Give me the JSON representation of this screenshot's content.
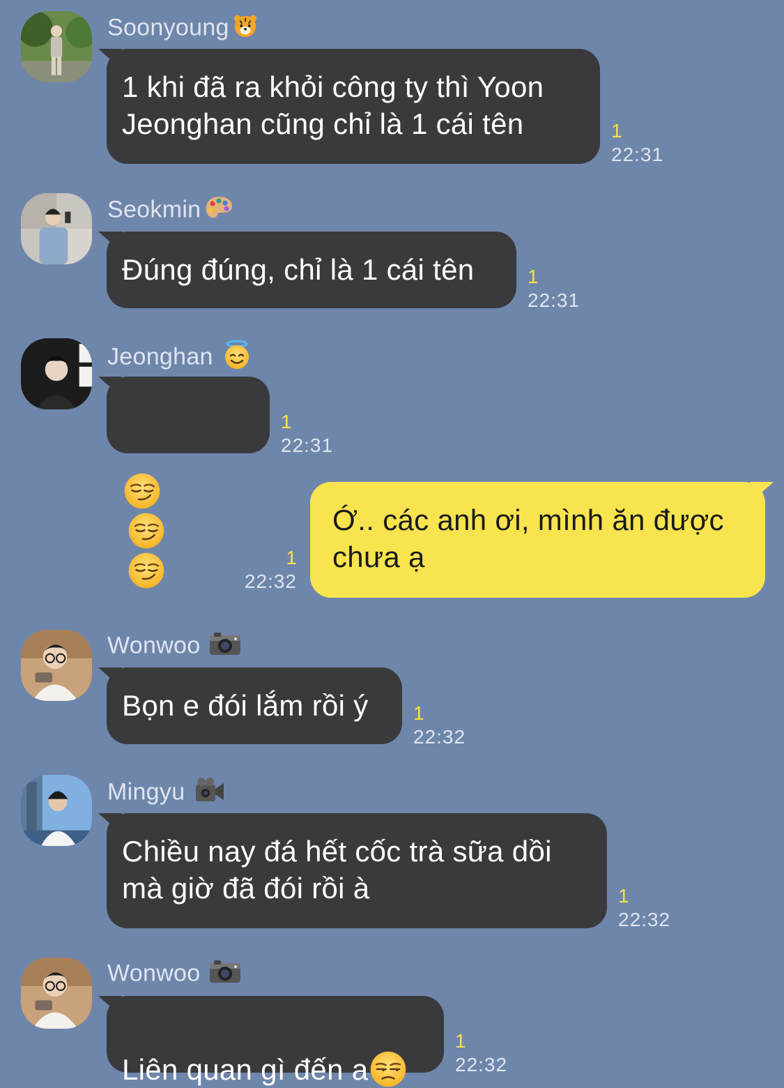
{
  "accent_colors": {
    "background": "#6f86ab",
    "incoming_bubble": "#3a3a3c",
    "outgoing_bubble": "#f8e44e",
    "unread": "#f5e04a"
  },
  "messages": [
    {
      "sender": "Soonyoung",
      "sender_icon": "tiger-icon",
      "text": "1 khi đã ra khỏi công ty thì Yoon\nJeonghan cũng chỉ là 1 cái tên",
      "unread": "1",
      "time": "22:31"
    },
    {
      "sender": "Seokmin",
      "sender_icon": "palette-icon",
      "text": "Đúng đúng, chỉ là 1 cái tên",
      "unread": "1",
      "time": "22:31"
    },
    {
      "sender": "Jeonghan",
      "sender_icon": "angel-face-icon",
      "text": "",
      "emojis": [
        "smirk-face-icon",
        "smirk-face-icon",
        "smirk-face-icon"
      ],
      "unread": "1",
      "time": "22:31"
    },
    {
      "sender": "",
      "mine": true,
      "text": "Ớ.. các anh ơi, mình ăn được\nchưa ạ",
      "unread": "1",
      "time": "22:32"
    },
    {
      "sender": "Wonwoo",
      "sender_icon": "camera-icon",
      "text": "Bọn e đói lắm rồi ý",
      "unread": "1",
      "time": "22:32"
    },
    {
      "sender": "Mingyu",
      "sender_icon": "video-camera-icon",
      "text": "Chiều nay đá hết cốc trà sữa dồi\nmà giờ đã đói rồi à",
      "unread": "1",
      "time": "22:32"
    },
    {
      "sender": "Wonwoo",
      "sender_icon": "camera-icon",
      "text": "Liên quan gì đến a",
      "trailing_emoji": "unamused-face-icon",
      "unread": "1",
      "time": "22:32"
    }
  ]
}
